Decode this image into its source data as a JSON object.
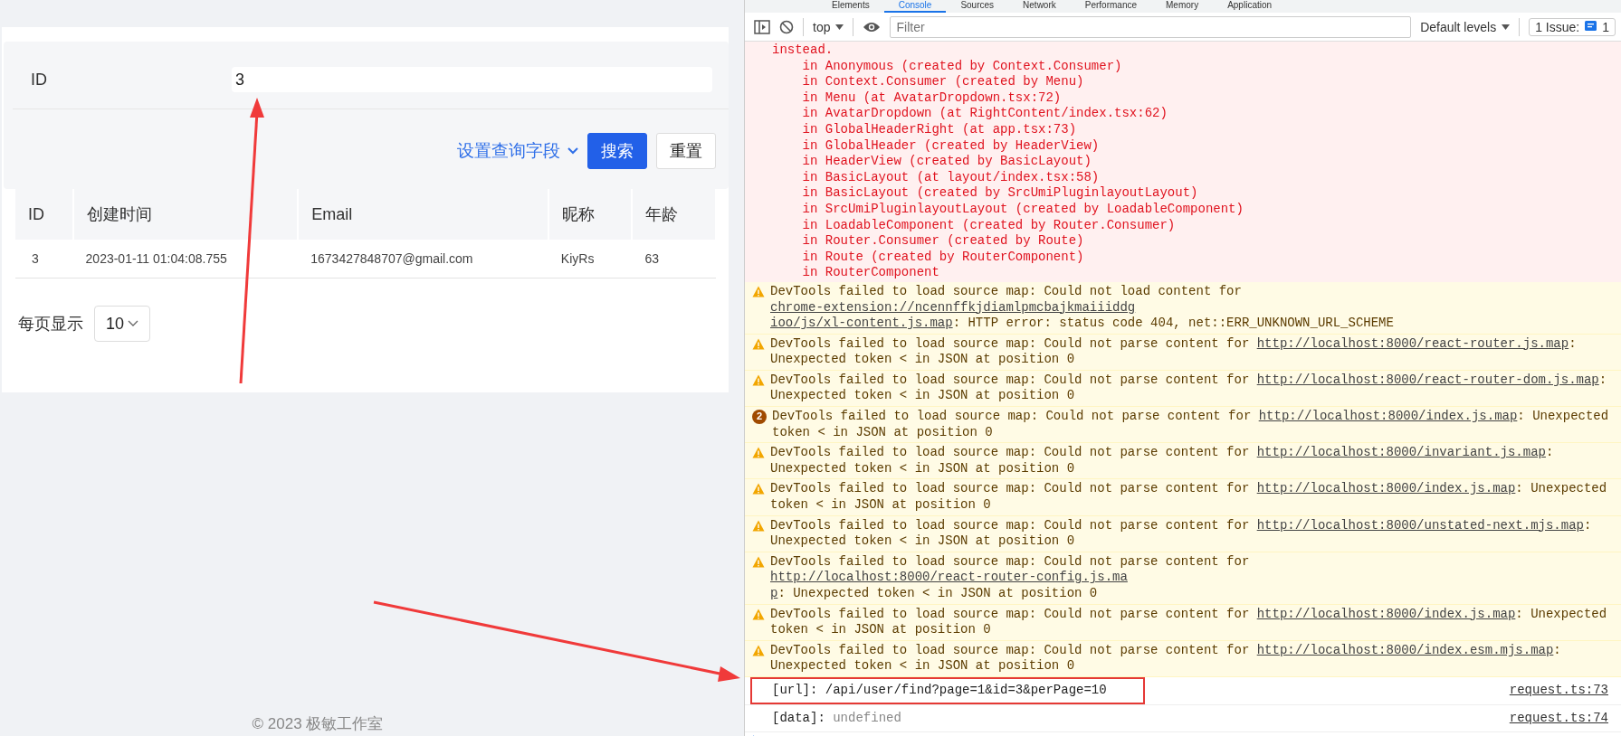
{
  "page": {
    "search_form": {
      "field_label": "ID",
      "field_value": "3",
      "fields_link": "设置查询字段",
      "search_button": "搜索",
      "reset_button": "重置"
    },
    "table": {
      "columns": [
        "ID",
        "创建时间",
        "Email",
        "昵称",
        "年龄"
      ],
      "rows": [
        [
          "3",
          "2023-01-11 01:04:08.755",
          "1673427848707@gmail.com",
          "KiyRs",
          "63"
        ]
      ]
    },
    "pagination": {
      "label": "每页显示",
      "page_size": "10"
    },
    "footer": "© 2023 极敏工作室"
  },
  "devtools": {
    "tabs": [
      {
        "label": "Elements",
        "selected": false
      },
      {
        "label": "Console",
        "selected": true
      },
      {
        "label": "Sources",
        "selected": false
      },
      {
        "label": "Network",
        "selected": false
      },
      {
        "label": "Performance",
        "selected": false
      },
      {
        "label": "Memory",
        "selected": false
      },
      {
        "label": "Application",
        "selected": false
      }
    ],
    "toolbar": {
      "context": "top",
      "filter_placeholder": "Filter",
      "levels": "Default levels",
      "issues_label": "1 Issue:",
      "issues_count": "1"
    },
    "messages": [
      {
        "kind": "error",
        "lines": [
          "instead.",
          "    in Anonymous (created by Context.Consumer)",
          "    in Context.Consumer (created by Menu)",
          "    in Menu (at AvatarDropdown.tsx:72)",
          "    in AvatarDropdown (at RightContent/index.tsx:62)",
          "    in GlobalHeaderRight (at app.tsx:73)",
          "    in GlobalHeader (created by HeaderView)",
          "    in HeaderView (created by BasicLayout)",
          "    in BasicLayout (at layout/index.tsx:58)",
          "    in BasicLayout (created by SrcUmiPluginlayoutLayout)",
          "    in SrcUmiPluginlayoutLayout (created by LoadableComponent)",
          "    in LoadableComponent (created by Router.Consumer)",
          "    in Router.Consumer (created by Route)",
          "    in Route (created by RouterComponent)",
          "    in RouterComponent"
        ]
      },
      {
        "kind": "warning",
        "text": "DevTools failed to load source map: Could not load content for ",
        "url": [
          "chrome-extension://ncennffkjdiamlpmcbajkmaiiiddg",
          "ioo/js/xl-content.js.map"
        ],
        "suffix": ": HTTP error: status code 404, net::ERR_UNKNOWN_URL_SCHEME"
      },
      {
        "kind": "warning",
        "text": "DevTools failed to load source map: Could not parse content for ",
        "url": "http://localhost:8000/react-router.js.map",
        "suffix": ": Unexpected token < in JSON at position 0"
      },
      {
        "kind": "warning",
        "text": "DevTools failed to load source map: Could not parse content for ",
        "url": "http://localhost:8000/react-router-dom.js.map",
        "suffix": ": Unexpected token < in JSON at position 0"
      },
      {
        "kind": "grouped",
        "count": "2",
        "text": "DevTools failed to load source map: Could not parse content for ",
        "url": "http://localhost:8000/index.js.map",
        "suffix": ": Unexpected token < in JSON at position 0"
      },
      {
        "kind": "warning",
        "text": "DevTools failed to load source map: Could not parse content for ",
        "url": "http://localhost:8000/invariant.js.map",
        "suffix": ": Unexpected token < in JSON at position 0"
      },
      {
        "kind": "warning",
        "text": "DevTools failed to load source map: Could not parse content for ",
        "url": "http://localhost:8000/index.js.map",
        "suffix": ": Unexpected token < in JSON at position 0"
      },
      {
        "kind": "warning",
        "text": "DevTools failed to load source map: Could not parse content for ",
        "url": "http://localhost:8000/unstated-next.mjs.map",
        "suffix": ": Unexpected token < in JSON at position 0"
      },
      {
        "kind": "warning",
        "text": "DevTools failed to load source map: Could not parse content for ",
        "url": [
          "http://localhost:8000/react-router-config.js.ma",
          "p"
        ],
        "suffix": ": Unexpected token < in JSON at position 0"
      },
      {
        "kind": "warning",
        "text": "DevTools failed to load source map: Could not parse content for ",
        "url": "http://localhost:8000/index.js.map",
        "suffix": ": Unexpected token < in JSON at position 0"
      },
      {
        "kind": "warning",
        "text": "DevTools failed to load source map: Could not parse content for ",
        "url": "http://localhost:8000/index.esm.mjs.map",
        "suffix": ": Unexpected token < in JSON at position 0"
      },
      {
        "kind": "log",
        "text": "[url]: /api/user/find?page=1&id=3&perPage=10",
        "source": "request.ts:73",
        "highlighted": true
      },
      {
        "kind": "log",
        "text": "[data]: ",
        "value": "undefined",
        "source": "request.ts:74",
        "highlighted": false
      }
    ]
  }
}
